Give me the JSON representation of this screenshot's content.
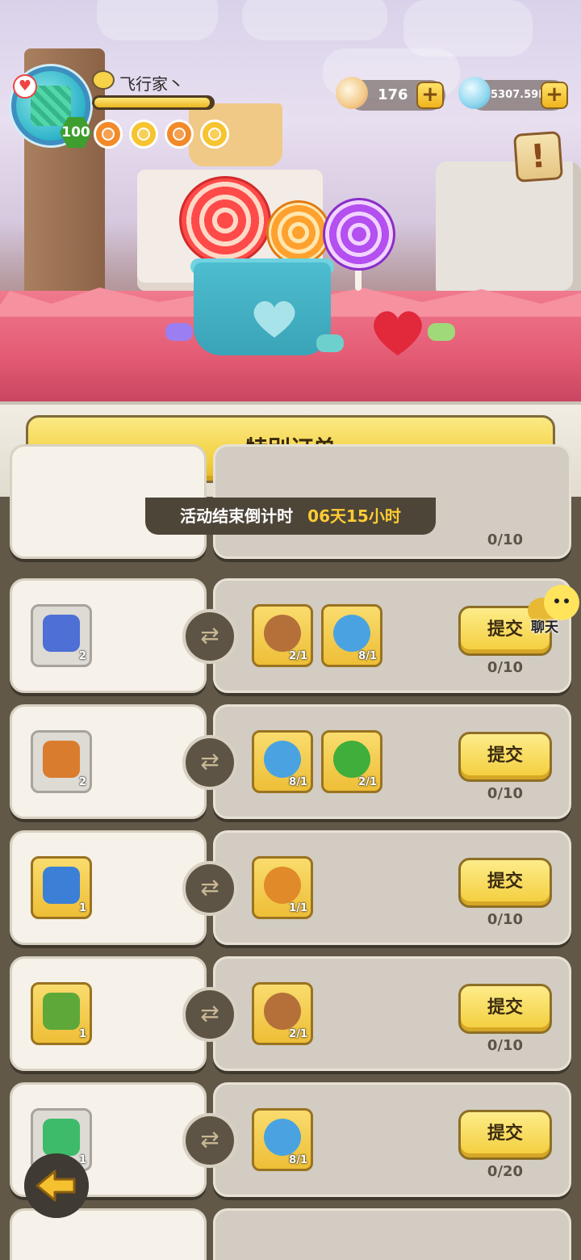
{
  "player": {
    "name": "飞行家丶",
    "level": "100",
    "xp_fraction": 0.98
  },
  "currencies": [
    {
      "id": "pearl",
      "value": "176",
      "icon": "shell-pearl-icon"
    },
    {
      "id": "gem",
      "value": "5307.59M",
      "icon": "blue-gem-icon"
    }
  ],
  "panel": {
    "title": "特别订单",
    "countdown_label": "活动结束倒计时",
    "countdown_value": "06天15小时"
  },
  "chat": {
    "label": "聊天"
  },
  "orders": [
    {
      "reward": {
        "icon": "hidden-item",
        "count": ""
      },
      "requirements": [],
      "progress": "0/10",
      "submit": ""
    },
    {
      "reward": {
        "icon": "blue-crystal-icon",
        "count": "2"
      },
      "requirements": [
        {
          "icon": "slingshot-icon",
          "count": "2/1"
        },
        {
          "icon": "pinwheel-icon",
          "count": "8/1"
        }
      ],
      "progress": "0/10",
      "submit": "提交"
    },
    {
      "reward": {
        "icon": "scroll-map-icon",
        "count": "2"
      },
      "requirements": [
        {
          "icon": "pinwheel-icon",
          "count": "8/1"
        },
        {
          "icon": "clover-icon",
          "count": "2/1"
        }
      ],
      "progress": "0/10",
      "submit": "提交"
    },
    {
      "reward": {
        "icon": "blue-rune-icon",
        "count": "1"
      },
      "requirements": [
        {
          "icon": "snail-icon",
          "count": "1/1"
        }
      ],
      "progress": "0/10",
      "submit": "提交"
    },
    {
      "reward": {
        "icon": "green-golem-icon",
        "count": "1"
      },
      "requirements": [
        {
          "icon": "slingshot-icon",
          "count": "2/1"
        }
      ],
      "progress": "0/10",
      "submit": "提交"
    },
    {
      "reward": {
        "icon": "green-ticket-icon",
        "count": "1"
      },
      "requirements": [
        {
          "icon": "pinwheel-icon",
          "count": "8/1"
        }
      ],
      "progress": "0/20",
      "submit": "提交"
    }
  ]
}
